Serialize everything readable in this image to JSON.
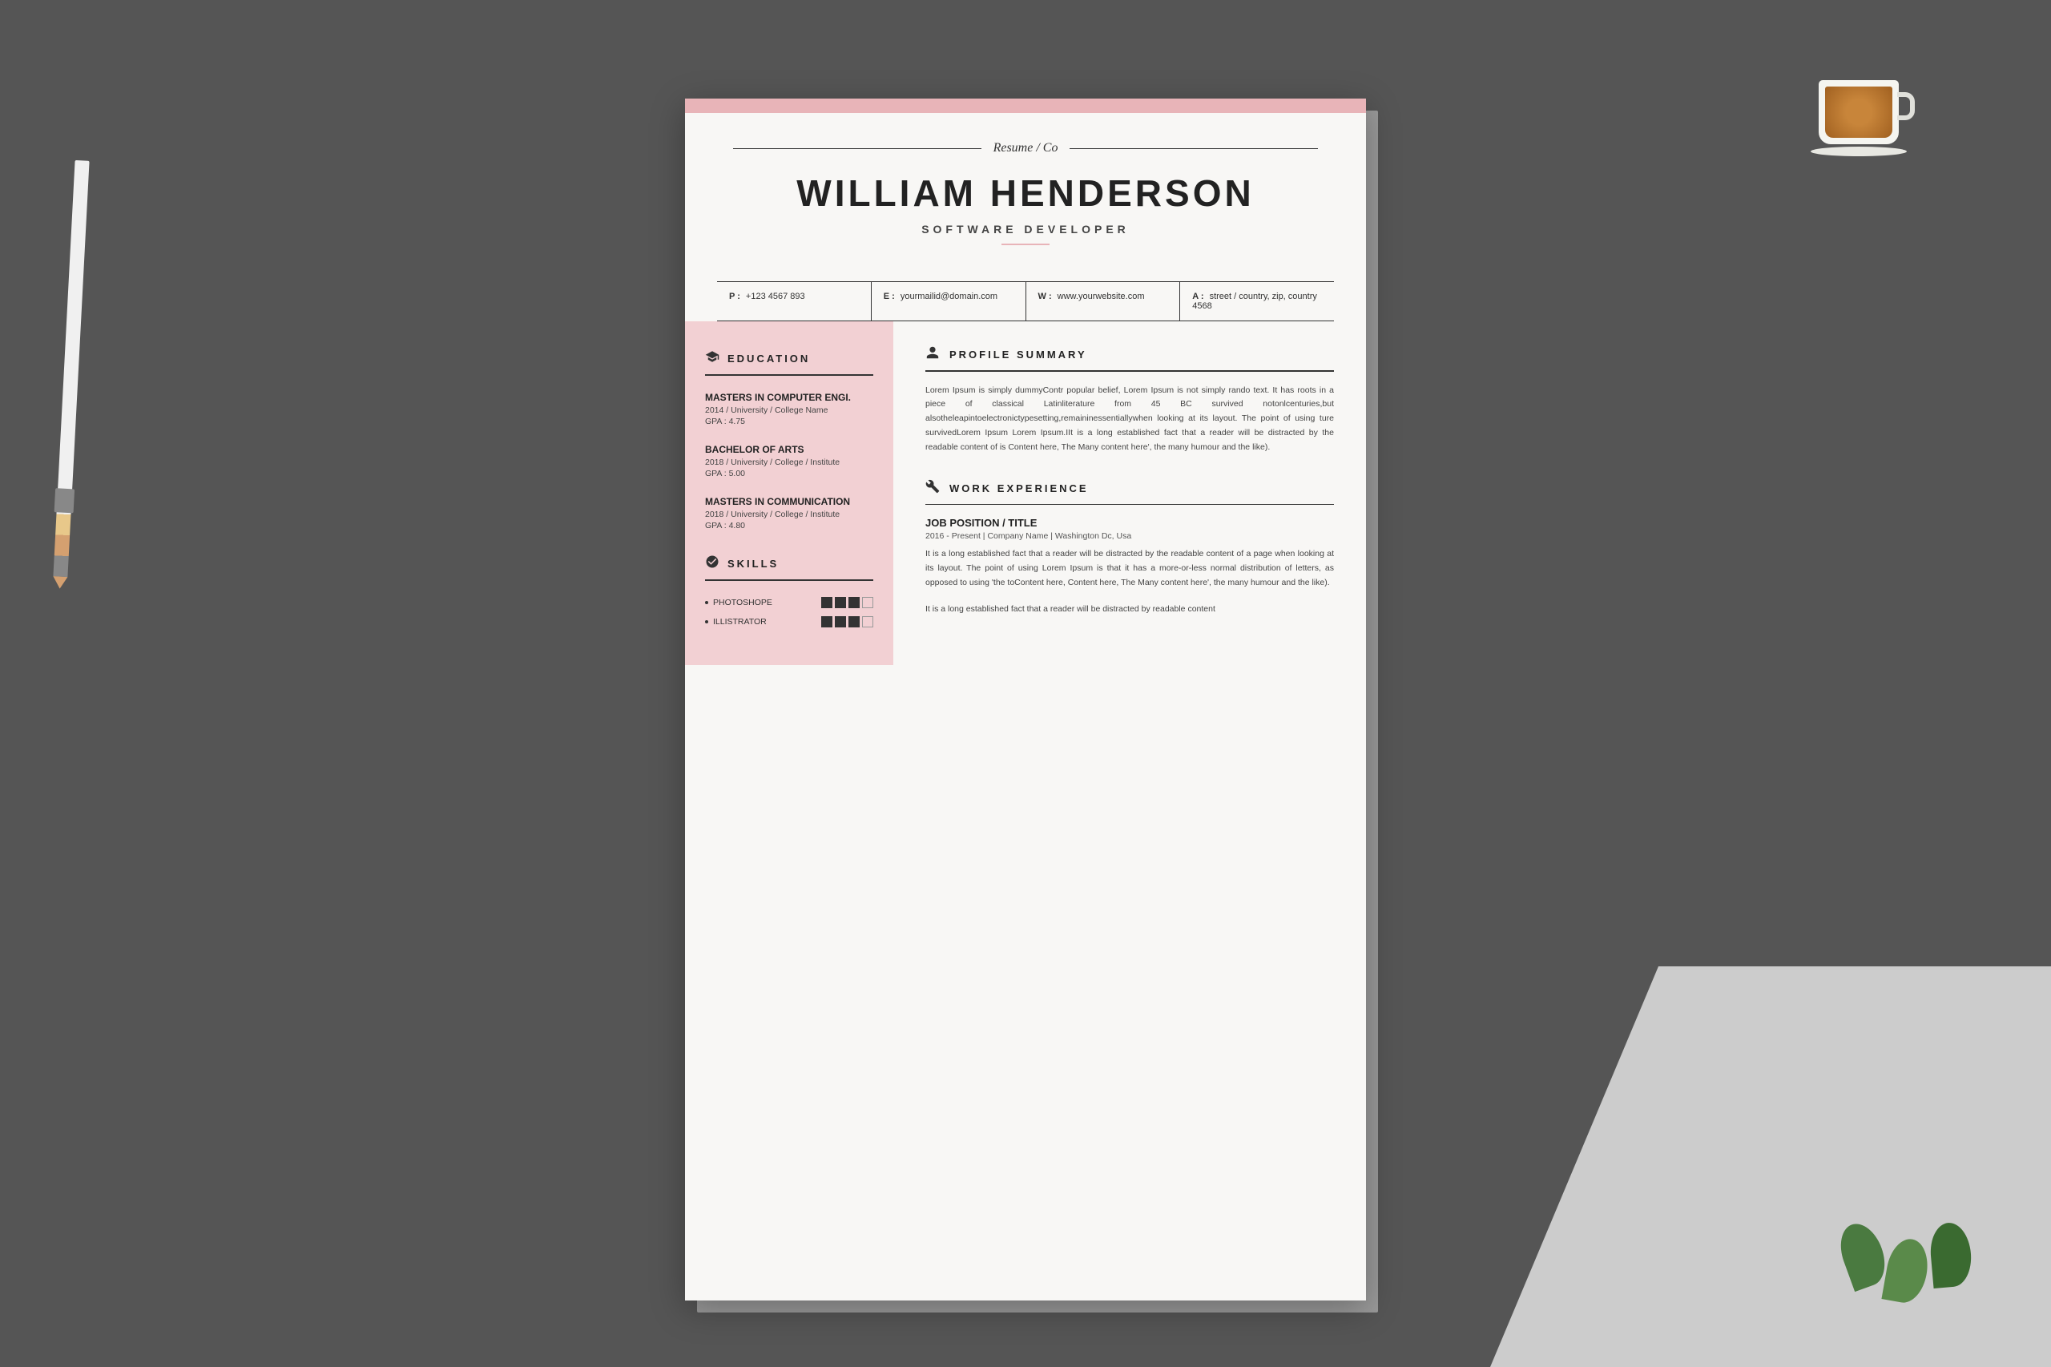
{
  "background": {
    "color": "#555555"
  },
  "resume": {
    "logo": "Resume / Co",
    "name": "WILLIAM HENDERSON",
    "title": "SOFTWARE DEVELOPER",
    "contact": {
      "phone_label": "P :",
      "phone": "+123 4567 893",
      "email_label": "E :",
      "email": "yourmailid@domain.com",
      "website_label": "W :",
      "website": "www.yourwebsite.com",
      "address_label": "A :",
      "address": "street / country, zip, country 4568"
    },
    "sidebar": {
      "education_title": "EDUCATION",
      "degrees": [
        {
          "degree": "MASTERS IN COMPUTER ENGI.",
          "details": "2014 / University / College Name",
          "gpa": "GPA : 4.75"
        },
        {
          "degree": "BACHELOR OF ARTS",
          "details": "2018 / University / College / Institute",
          "gpa": "GPA : 5.00"
        },
        {
          "degree": "MASTERS IN COMMUNICATION",
          "details": "2018 / University / College / Institute",
          "gpa": "GPA : 4.80"
        }
      ],
      "skills_title": "SKILLS",
      "skills": [
        {
          "name": "PHOTOSHOPE",
          "level": 3
        },
        {
          "name": "ILLISTRATOR",
          "level": 3
        }
      ]
    },
    "profile_summary": {
      "title": "PROFILE SUMMARY",
      "text": "Lorem Ipsum is simply dummyContr popular belief, Lorem Ipsum is not simply rando text. It has roots in a piece of classical Latinliterature from 45 BC survived notonlcenturies,but alsotheleapintoelectronictypesetting,remaininessentiallywhen looking at its layout. The point of using ture survivedLorem Ipsum Lorem Ipsum.IIt is a long established fact that a reader will be distracted by the readable content of is Content here, The Many content here', the many humour and the like)."
    },
    "work_experience": {
      "title": "WORK EXPERIENCE",
      "jobs": [
        {
          "title": "JOB POSITION / TITLE",
          "subtitle": "2016 - Present  |  Company Name  |  Washington Dc, Usa",
          "description": "It is a long established fact that a reader will be distracted by the readable content of a page when looking at its layout. The point of using Lorem Ipsum is that it has a more-or-less normal distribution of letters, as opposed to using 'the toContent here, Content here, The Many content here', the many humour and the like)."
        },
        {
          "title": "",
          "subtitle": "",
          "description": "It is a long established fact that a reader will be distracted by readable content"
        }
      ]
    }
  }
}
